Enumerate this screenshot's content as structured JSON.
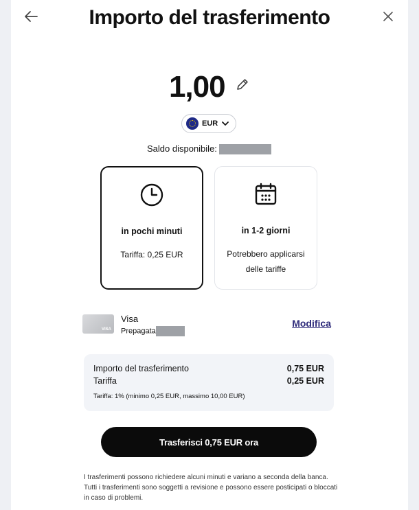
{
  "header": {
    "title": "Importo del trasferimento",
    "back_icon": "arrow-left-icon",
    "close_icon": "close-icon"
  },
  "amount": {
    "value": "1,00",
    "edit_icon": "pencil-icon"
  },
  "currency": {
    "code": "EUR",
    "flag_icon": "eu-flag-icon",
    "dropdown_icon": "chevron-down-icon"
  },
  "balance": {
    "label": "Saldo disponibile:"
  },
  "options": [
    {
      "icon": "clock-icon",
      "name": "in pochi minuti",
      "desc": "Tariffa: 0,25 EUR",
      "selected": true
    },
    {
      "icon": "calendar-icon",
      "name": "in 1-2 giorni",
      "desc": "Potrebbero applicarsi delle tariffe",
      "selected": false
    }
  ],
  "card": {
    "brand": "Visa",
    "type": "Prepagata",
    "thumb_label": "VISA",
    "modify_label": "Modifica"
  },
  "summary": {
    "rows": [
      {
        "label": "Importo del trasferimento",
        "value": "0,75 EUR"
      },
      {
        "label": "Tariffa",
        "value": "0,25 EUR"
      }
    ],
    "note": "Tariffa: 1% (minimo 0,25 EUR, massimo 10,00 EUR)"
  },
  "cta": {
    "label": "Trasferisci 0,75 EUR ora"
  },
  "disclaimer": "I trasferimenti possono richiedere alcuni minuti e variano a seconda della banca. Tutti i trasferimenti sono soggetti a revisione e possono essere posticipati o bloccati in caso di problemi."
}
